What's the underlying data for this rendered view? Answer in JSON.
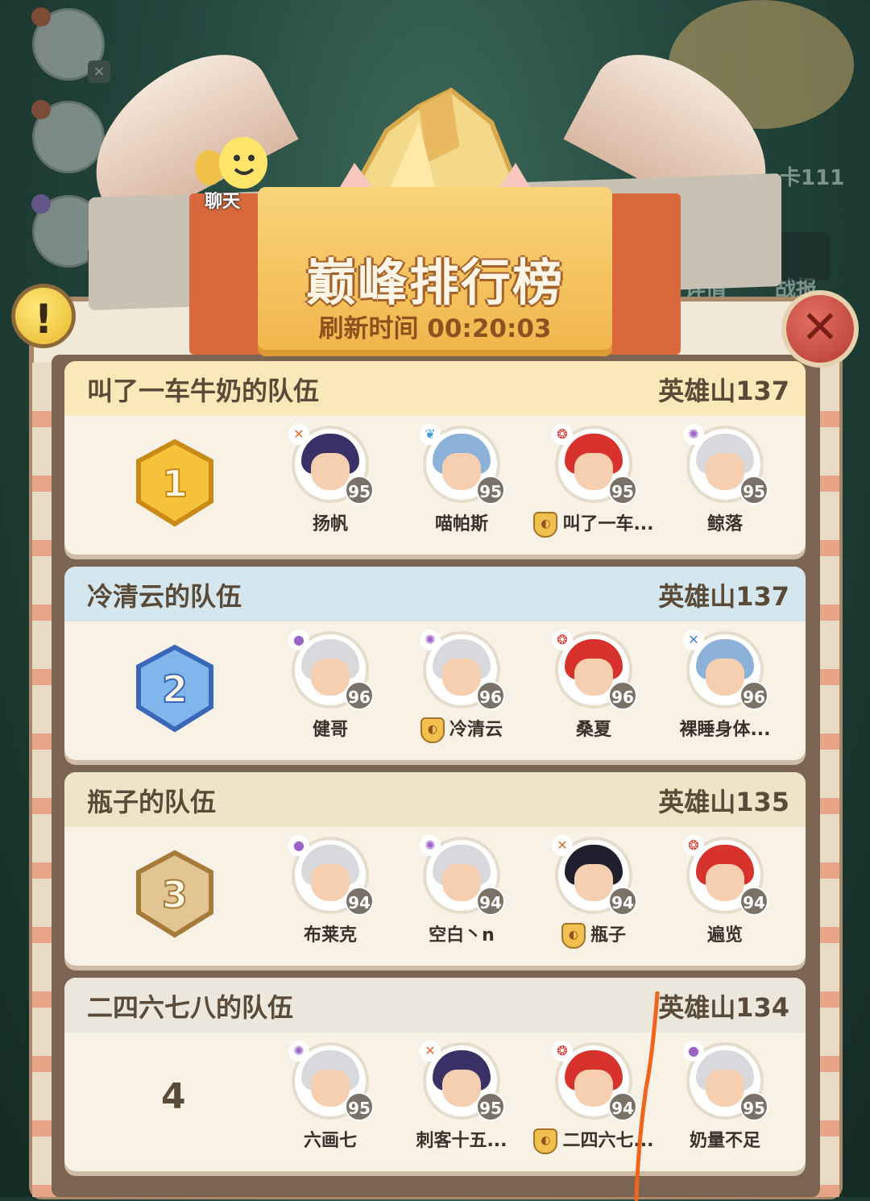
{
  "background": {
    "partial_text_1": "卡111",
    "partial_text_2": "详情",
    "partial_text_3": "战报"
  },
  "chat": {
    "label": "聊天"
  },
  "header": {
    "title": "巅峰排行榜",
    "refresh_text": "刷新时间 00:20:03"
  },
  "buttons": {
    "help": "!",
    "close": "✕"
  },
  "teams": [
    {
      "name": "叫了一车牛奶的队伍",
      "score": "英雄山137",
      "rank": "1",
      "head_color": "#f9e9b9",
      "members": [
        {
          "name": "扬帆",
          "level": "95",
          "class_icon": "crossbow-icon",
          "hair": "#3a3266",
          "leader": false
        },
        {
          "name": "喵帕斯",
          "level": "95",
          "class_icon": "leaf-icon",
          "hair": "#8db2d9",
          "leader": false
        },
        {
          "name": "叫了一车...",
          "level": "95",
          "class_icon": "flame-icon",
          "hair": "#d8322c",
          "leader": true
        },
        {
          "name": "鲸落",
          "level": "95",
          "class_icon": "swirl-icon",
          "hair": "#d7d9dc",
          "leader": false
        }
      ]
    },
    {
      "name": "冷清云的队伍",
      "score": "英雄山137",
      "rank": "2",
      "head_color": "#d5e7ee",
      "members": [
        {
          "name": "健哥",
          "level": "96",
          "class_icon": "orb-icon",
          "hair": "#d7d9dc",
          "leader": false
        },
        {
          "name": "冷清云",
          "level": "96",
          "class_icon": "swirl-icon",
          "hair": "#d7d9dc",
          "leader": true
        },
        {
          "name": "桑夏",
          "level": "96",
          "class_icon": "flame-icon",
          "hair": "#d8322c",
          "leader": false
        },
        {
          "name": "裸睡身体...",
          "level": "96",
          "class_icon": "crossed-swords-icon",
          "hair": "#8db2d9",
          "leader": false
        }
      ]
    },
    {
      "name": "瓶子的队伍",
      "score": "英雄山135",
      "rank": "3",
      "head_color": "#f0e4c8",
      "members": [
        {
          "name": "布莱克",
          "level": "94",
          "class_icon": "orb-icon",
          "hair": "#d7d9dc",
          "leader": false
        },
        {
          "name": "空白丶n",
          "level": "94",
          "class_icon": "swirl-icon",
          "hair": "#d7d9dc",
          "leader": false
        },
        {
          "name": "瓶子",
          "level": "94",
          "class_icon": "crossbow-icon",
          "hair": "#1f1f2e",
          "leader": true
        },
        {
          "name": "遍览",
          "level": "94",
          "class_icon": "flame-icon",
          "hair": "#d8322c",
          "leader": false
        }
      ]
    },
    {
      "name": "二四六七八的队伍",
      "score": "英雄山134",
      "rank": "4",
      "head_color": "#ece7dd",
      "members": [
        {
          "name": "六画七",
          "level": "95",
          "class_icon": "swirl-icon",
          "hair": "#d7d9dc",
          "leader": false
        },
        {
          "name": "刺客十五...",
          "level": "95",
          "class_icon": "crossbow-icon",
          "hair": "#3a3266",
          "leader": false
        },
        {
          "name": "二四六七...",
          "level": "94",
          "class_icon": "flame-icon",
          "hair": "#d8322c",
          "leader": true
        },
        {
          "name": "奶量不足",
          "level": "95",
          "class_icon": "orb-icon",
          "hair": "#d7d9dc",
          "leader": false
        }
      ]
    }
  ]
}
